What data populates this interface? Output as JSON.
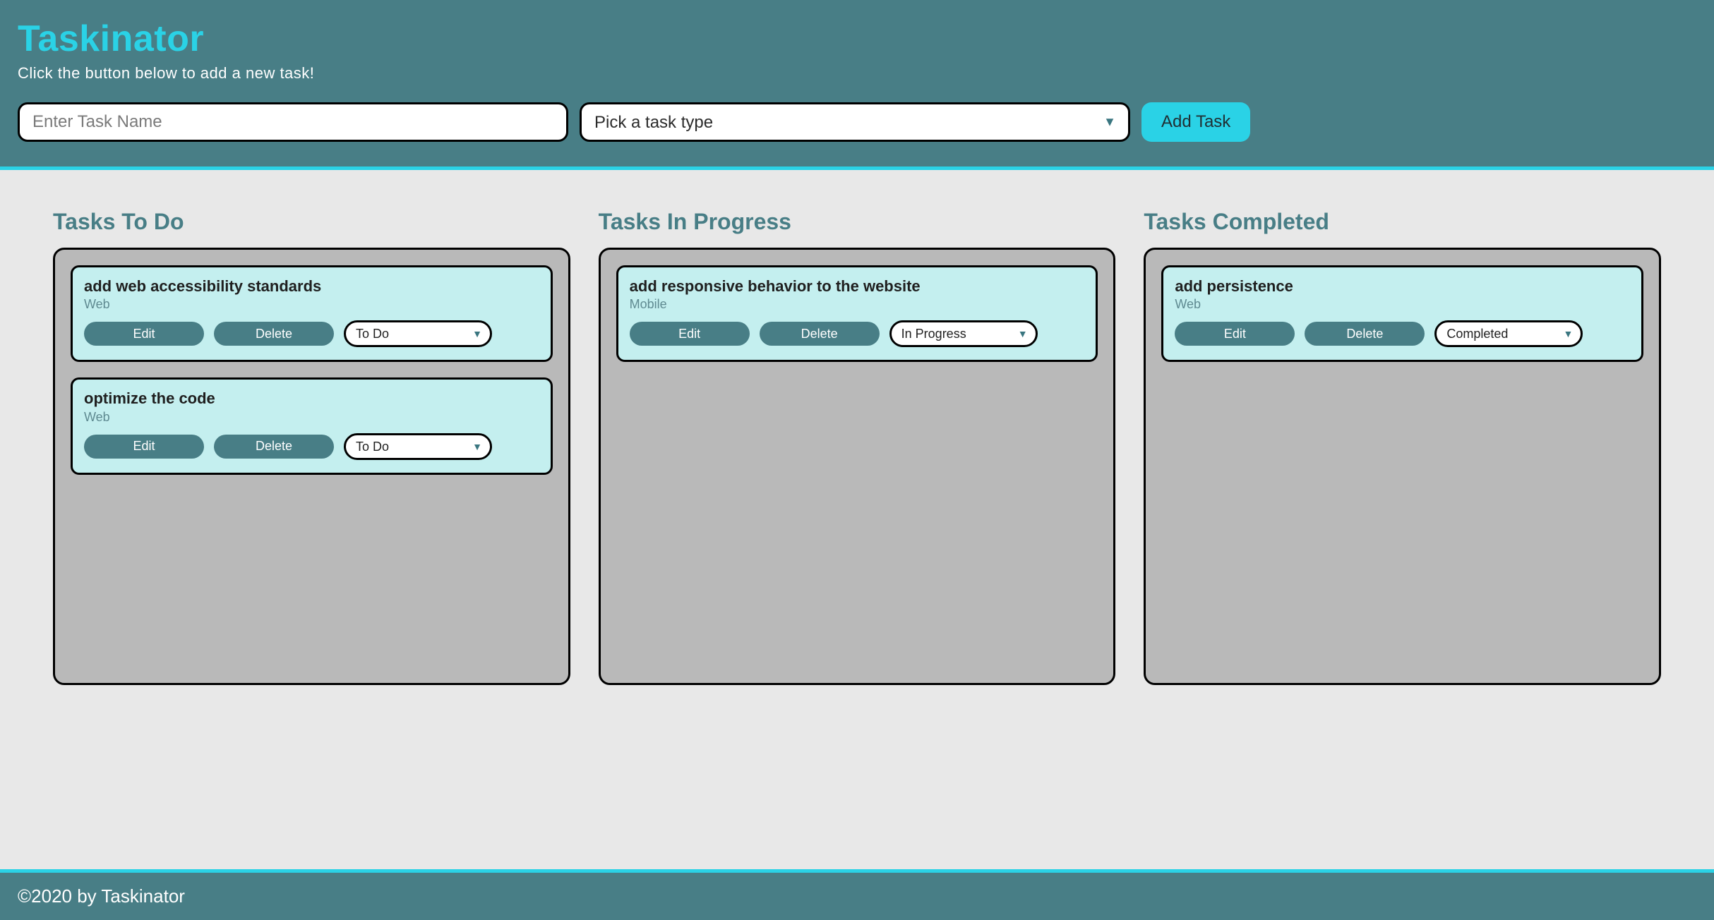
{
  "header": {
    "title": "Taskinator",
    "subtitle": "Click the button below to add a new task!",
    "input_placeholder": "Enter Task Name",
    "select_placeholder": "Pick a task type",
    "add_button": "Add Task"
  },
  "status_options": [
    "To Do",
    "In Progress",
    "Completed"
  ],
  "columns": {
    "todo": {
      "title": "Tasks To Do",
      "tasks": [
        {
          "title": "add web accessibility standards",
          "type": "Web",
          "status": "To Do"
        },
        {
          "title": "optimize the code",
          "type": "Web",
          "status": "To Do"
        }
      ]
    },
    "in_progress": {
      "title": "Tasks In Progress",
      "tasks": [
        {
          "title": "add responsive behavior to the website",
          "type": "Mobile",
          "status": "In Progress"
        }
      ]
    },
    "completed": {
      "title": "Tasks Completed",
      "tasks": [
        {
          "title": "add persistence",
          "type": "Web",
          "status": "Completed"
        }
      ]
    }
  },
  "buttons": {
    "edit": "Edit",
    "delete": "Delete"
  },
  "footer": "©2020 by Taskinator"
}
